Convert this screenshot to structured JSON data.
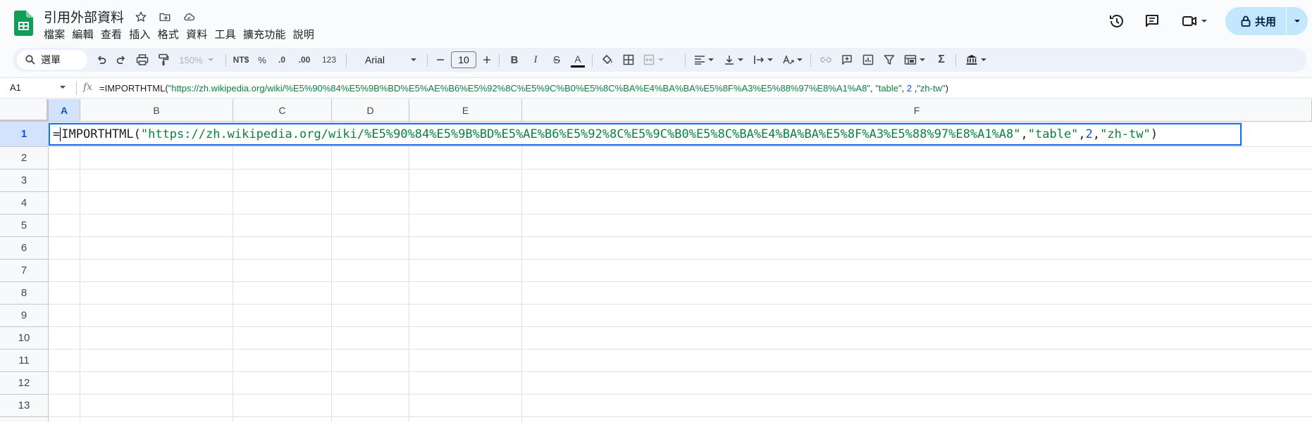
{
  "header": {
    "doc_title": "引用外部資料",
    "menu": [
      "檔案",
      "編輯",
      "查看",
      "插入",
      "格式",
      "資料",
      "工具",
      "擴充功能",
      "說明"
    ],
    "share_label": "共用"
  },
  "toolbar": {
    "search_label": "選單",
    "zoom": "150%",
    "currency": "NT$",
    "percent": "%",
    "decrease_decimal": ".0",
    "increase_decimal": ".00",
    "number_format": "123",
    "font": "Arial",
    "font_size": "10",
    "bold": "B",
    "italic": "I",
    "strike": "S",
    "text_color": "A",
    "sigma": "Σ"
  },
  "formula_bar": {
    "cell_ref": "A1",
    "fx": "fx",
    "func": "=IMPORTHTML",
    "open": "(",
    "url": "\"https://zh.wikipedia.org/wiki/%E5%90%84%E5%9B%BD%E5%AE%B6%E5%92%8C%E5%9C%B0%E5%8C%BA%E4%BA%BA%E5%8F%A3%E5%88%97%E8%A1%A8\"",
    "sep1": ", ",
    "arg2": "\"table\"",
    "sep2": ", ",
    "arg3": "2",
    "sep3": " ,",
    "arg4": "\"zh-tw\"",
    "close": ")"
  },
  "edit_cell": {
    "func": "IMPORTHTML",
    "prefix": "="
  },
  "grid": {
    "columns": [
      "A",
      "B",
      "C",
      "D",
      "E",
      "F"
    ],
    "rows": [
      "1",
      "2",
      "3",
      "4",
      "5",
      "6",
      "7",
      "8",
      "9",
      "10",
      "11",
      "12",
      "13"
    ],
    "selected_column": "A",
    "selected_row": "1"
  },
  "colors": {
    "accent": "#1a73e8",
    "share_bg": "#c2e7ff",
    "string": "#0b8043",
    "number": "#1155cc"
  }
}
